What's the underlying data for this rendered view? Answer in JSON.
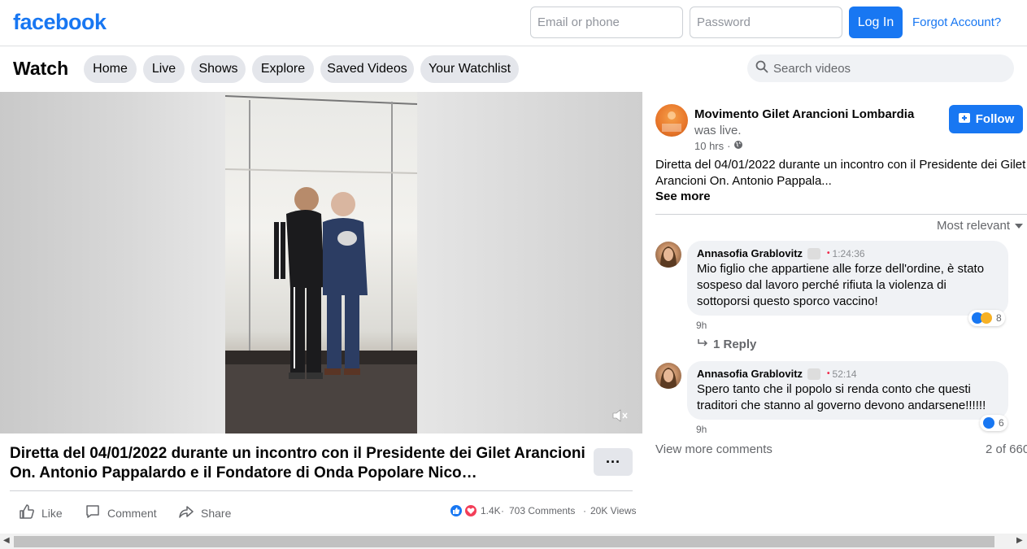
{
  "header": {
    "logo": "facebook",
    "email_placeholder": "Email or phone",
    "password_placeholder": "Password",
    "login_label": "Log In",
    "forgot_label": "Forgot Account?"
  },
  "watch": {
    "title": "Watch",
    "nav": [
      "Home",
      "Live",
      "Shows",
      "Explore",
      "Saved Videos",
      "Your Watchlist"
    ],
    "search_placeholder": "Search videos"
  },
  "video": {
    "title": "Diretta del 04/01/2022 durante un incontro con il Presidente dei Gilet Arancioni On. Antonio Pappalardo e il Fondatore di Onda Popolare Nico…",
    "more_label": "···",
    "actions": [
      "Like",
      "Comment",
      "Share"
    ],
    "reactions_count": "1.4K",
    "comments_count": "703 Comments",
    "views_count": "20K Views",
    "sep": "·"
  },
  "post": {
    "page_name": "Movimento Gilet Arancioni Lombardia",
    "was_live": "was live.",
    "time": "10 hrs",
    "time_sep": "·",
    "follow_label": "Follow",
    "description_line1": "Diretta del 04/01/2022 durante un incontro con il Presidente dei Gilet",
    "description_line2": "Arancioni On. Antonio Pappala...",
    "see_more": "See more",
    "sort_label": "Most relevant"
  },
  "comments": [
    {
      "author": "Annasofia Grablovitz",
      "timestamp": "1:24:36",
      "text": "Mio figlio che appartiene alle forze dell'ordine, è stato sospeso dal lavoro perché rifiuta la violenza di sottoporsi questo sporco vaccino!",
      "age": "9h",
      "reactions": "8",
      "replies_label": "1 Reply"
    },
    {
      "author": "Annasofia Grablovitz",
      "timestamp": "52:14",
      "text": "Spero tanto che il popolo si renda conto che questi traditori che stanno al governo devono andarsene!!!!!!",
      "age": "9h",
      "reactions": "6"
    }
  ],
  "comments_footer": {
    "view_more": "View more comments",
    "count": "2 of 660"
  },
  "colors": {
    "brand": "#1877f2",
    "pill": "#e4e6eb",
    "bubble": "#f0f2f5",
    "muted": "#65676b"
  }
}
